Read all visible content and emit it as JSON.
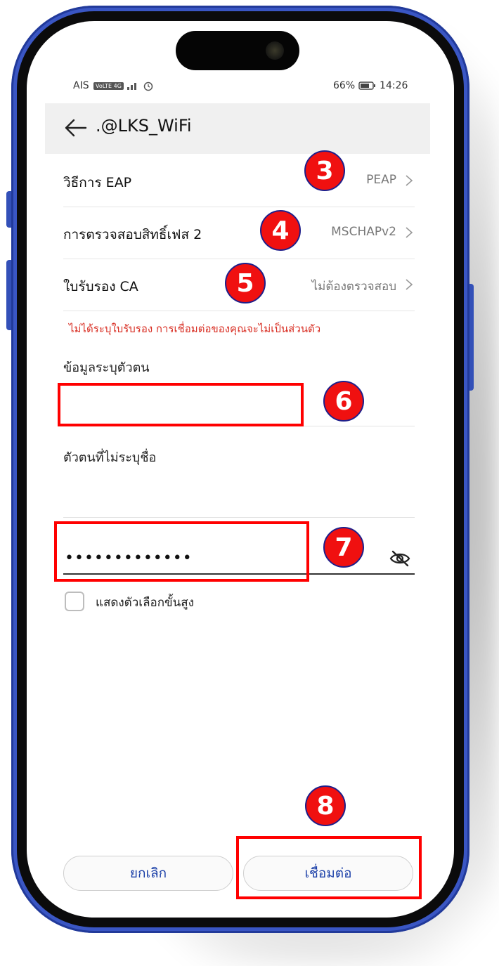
{
  "status_bar": {
    "carrier": "AIS",
    "network": "VoLTE 4G",
    "battery": "66%",
    "time": "14:26"
  },
  "header": {
    "title": ".@LKS_WiFi"
  },
  "settings": [
    {
      "label": "วิธีการ EAP",
      "value": "PEAP"
    },
    {
      "label": "การตรวจสอบสิทธิ์เฟส 2",
      "value": "MSCHAPv2"
    },
    {
      "label": "ใบรับรอง CA",
      "value": "ไม่ต้องตรวจสอบ"
    }
  ],
  "warning": "ไม่ได้ระบุใบรับรอง การเชื่อมต่อของคุณจะไม่เป็นส่วนตัว",
  "identity": {
    "label": "ข้อมูลระบุตัวตน",
    "value": ""
  },
  "anonymous": {
    "label": "ตัวตนที่ไม่ระบุชื่อ",
    "value": ""
  },
  "password": {
    "masked": "•••••••••••••"
  },
  "advanced": {
    "label": "แสดงตัวเลือกขั้นสูง",
    "checked": false
  },
  "buttons": {
    "cancel": "ยกเลิก",
    "connect": "เชื่อมต่อ"
  },
  "steps": [
    "3",
    "4",
    "5",
    "6",
    "7",
    "8"
  ],
  "colors": {
    "badge": "#f01010",
    "highlight": "#ff0000",
    "warning": "#d93025",
    "button_text": "#1a3fa8",
    "frame": "#3a56c4"
  }
}
